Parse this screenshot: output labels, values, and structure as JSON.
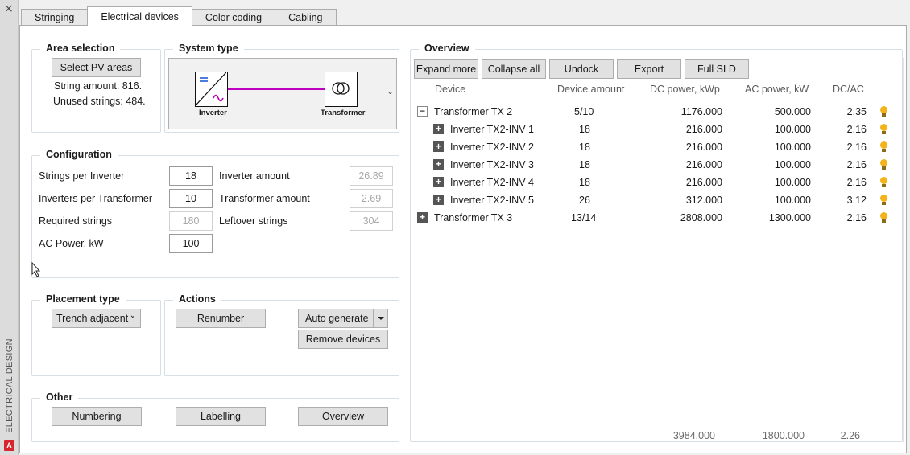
{
  "palette": {
    "title": "ELECTRICAL DESIGN",
    "close": "×",
    "logo": "A"
  },
  "tabs": [
    "Stringing",
    "Electrical devices",
    "Color coding",
    "Cabling"
  ],
  "area_selection": {
    "title": "Area selection",
    "button": "Select PV areas",
    "string_amount": "String amount: 816.",
    "unused_strings": "Unused strings: 484."
  },
  "system_type": {
    "title": "System type",
    "inverter": "Inverter",
    "transformer": "Transformer",
    "chevron": "⌄"
  },
  "configuration": {
    "title": "Configuration",
    "strings_per_inverter": {
      "label": "Strings per Inverter",
      "value": "18"
    },
    "inverters_per_transformer": {
      "label": "Inverters per Transformer",
      "value": "10"
    },
    "required_strings": {
      "label": "Required strings",
      "value": "180"
    },
    "ac_power": {
      "label": "AC Power, kW",
      "value": "100"
    },
    "inverter_amount": {
      "label": "Inverter amount",
      "value": "26.89"
    },
    "transformer_amount": {
      "label": "Transformer amount",
      "value": "2.69"
    },
    "leftover_strings": {
      "label": "Leftover strings",
      "value": "304"
    }
  },
  "placement": {
    "title": "Placement type",
    "selected": "Trench adjacent",
    "arrow": "⌄"
  },
  "actions": {
    "title": "Actions",
    "renumber": "Renumber",
    "auto_generate": "Auto generate",
    "remove_devices": "Remove devices"
  },
  "other": {
    "title": "Other",
    "numbering": "Numbering",
    "labelling": "Labelling",
    "overview": "Overview"
  },
  "overview": {
    "title": "Overview",
    "buttons": [
      "Expand more",
      "Collapse all",
      "Undock",
      "Export",
      "Full SLD"
    ],
    "columns": [
      "Device",
      "Device amount",
      "DC power, kWp",
      "AC power, kW",
      "DC/AC"
    ],
    "rows": [
      {
        "toggle": "−",
        "device": "Transformer TX 2",
        "amount": "5/10",
        "dc": "1176.000",
        "ac": "500.000",
        "ratio": "2.35"
      },
      {
        "toggle": "+",
        "device": "Inverter TX2-INV 1",
        "amount": "18",
        "dc": "216.000",
        "ac": "100.000",
        "ratio": "2.16"
      },
      {
        "toggle": "+",
        "device": "Inverter TX2-INV 2",
        "amount": "18",
        "dc": "216.000",
        "ac": "100.000",
        "ratio": "2.16"
      },
      {
        "toggle": "+",
        "device": "Inverter TX2-INV 3",
        "amount": "18",
        "dc": "216.000",
        "ac": "100.000",
        "ratio": "2.16"
      },
      {
        "toggle": "+",
        "device": "Inverter TX2-INV 4",
        "amount": "18",
        "dc": "216.000",
        "ac": "100.000",
        "ratio": "2.16"
      },
      {
        "toggle": "+",
        "device": "Inverter TX2-INV 5",
        "amount": "26",
        "dc": "312.000",
        "ac": "100.000",
        "ratio": "3.12"
      },
      {
        "toggle": "+",
        "device": "Transformer TX 3",
        "amount": "13/14",
        "dc": "2808.000",
        "ac": "1300.000",
        "ratio": "2.16"
      }
    ],
    "totals": {
      "dc": "3984.000",
      "ac": "1800.000",
      "ratio": "2.26"
    }
  }
}
